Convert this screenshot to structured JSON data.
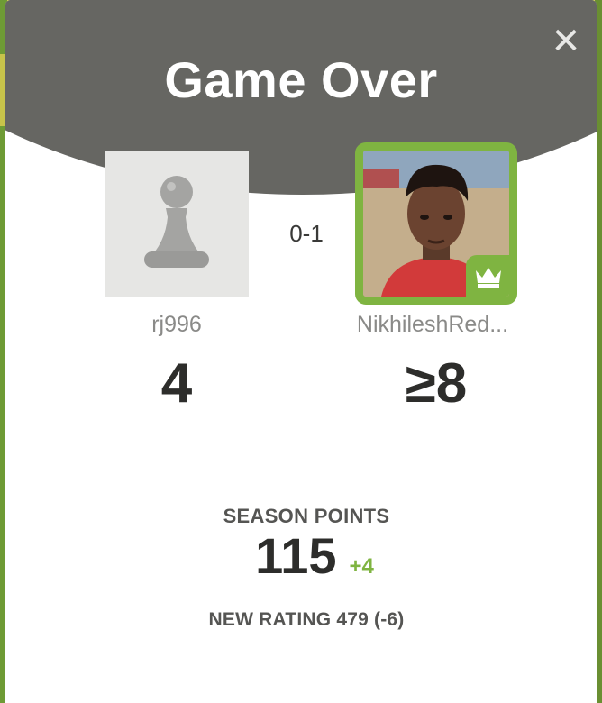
{
  "title": "Game Over",
  "close_icon": "close-icon",
  "players": {
    "left": {
      "name": "rj996",
      "rating_change": "4",
      "avatar_icon": "pawn-icon"
    },
    "right": {
      "name": "NikhileshRed...",
      "rating_change": "≥8",
      "badge_icon": "crown-icon"
    }
  },
  "result": "0-1",
  "season": {
    "label": "SEASON POINTS",
    "value": "115",
    "gain": "+4"
  },
  "new_rating": "NEW RATING 479 (-6)",
  "colors": {
    "header": "#666662",
    "accent_green": "#7fb441",
    "text_dark": "#2d2d2b",
    "text_muted": "#8a8a88"
  }
}
